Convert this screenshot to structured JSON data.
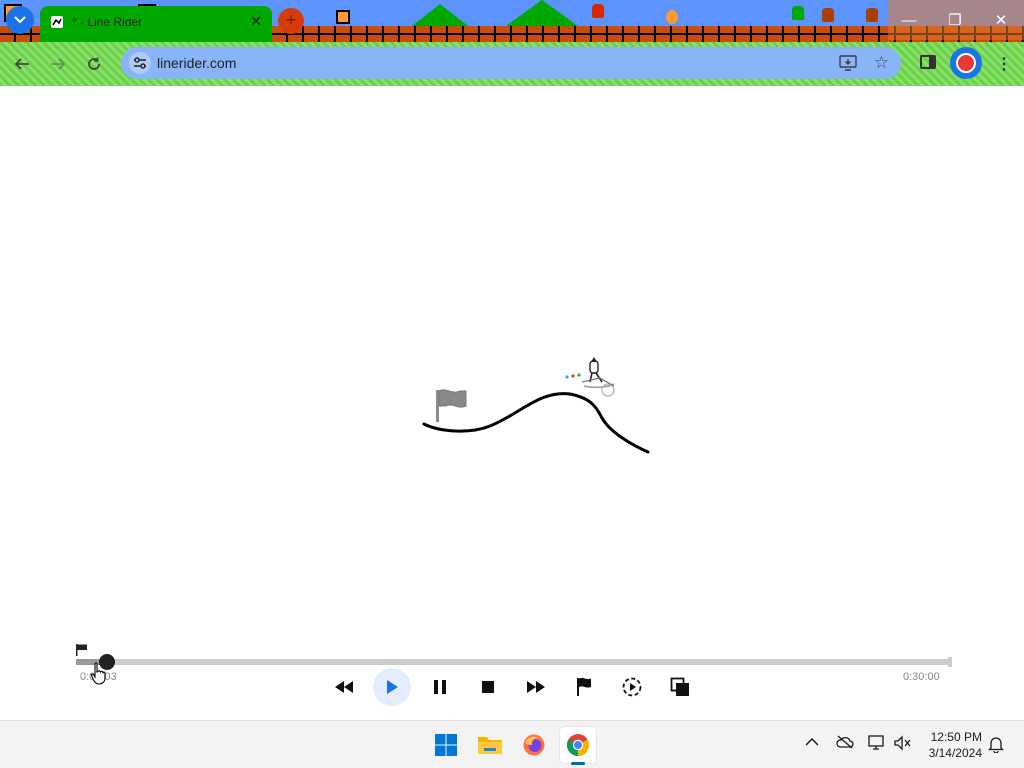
{
  "browser": {
    "tab": {
      "title": "* - Line Rider",
      "close_glyph": "✕"
    },
    "new_tab_glyph": "+",
    "url": "linerider.com",
    "window_controls": {
      "minimize": "—",
      "restore": "❐",
      "close": "✕"
    },
    "theme_colors": {
      "sky": "#5c94fc",
      "brick": "#c84c0c",
      "toolbar_green": "#6bd14c",
      "tab_green": "#00a800"
    }
  },
  "player": {
    "timeline": {
      "current_time": "0:00:03",
      "total_time": "0:30:00",
      "progress_fraction": 0.036
    },
    "controls": [
      {
        "name": "rewind",
        "icon": "rewind-icon"
      },
      {
        "name": "play",
        "icon": "play-icon"
      },
      {
        "name": "pause",
        "icon": "pause-icon"
      },
      {
        "name": "stop",
        "icon": "stop-icon"
      },
      {
        "name": "fast-forward",
        "icon": "fast-forward-icon"
      },
      {
        "name": "flag",
        "icon": "flag-icon"
      },
      {
        "name": "slow-motion",
        "icon": "slow-motion-icon"
      },
      {
        "name": "onion-skin",
        "icon": "onion-skin-icon"
      }
    ]
  },
  "taskbar": {
    "apps": [
      "start-icon",
      "file-explorer-icon",
      "firefox-icon",
      "chrome-icon"
    ],
    "tray": [
      "show-hidden-icons",
      "onedrive-icon",
      "network-icon",
      "volume-muted-icon"
    ],
    "clock": {
      "time": "12:50 PM",
      "date": "3/14/2024"
    }
  }
}
